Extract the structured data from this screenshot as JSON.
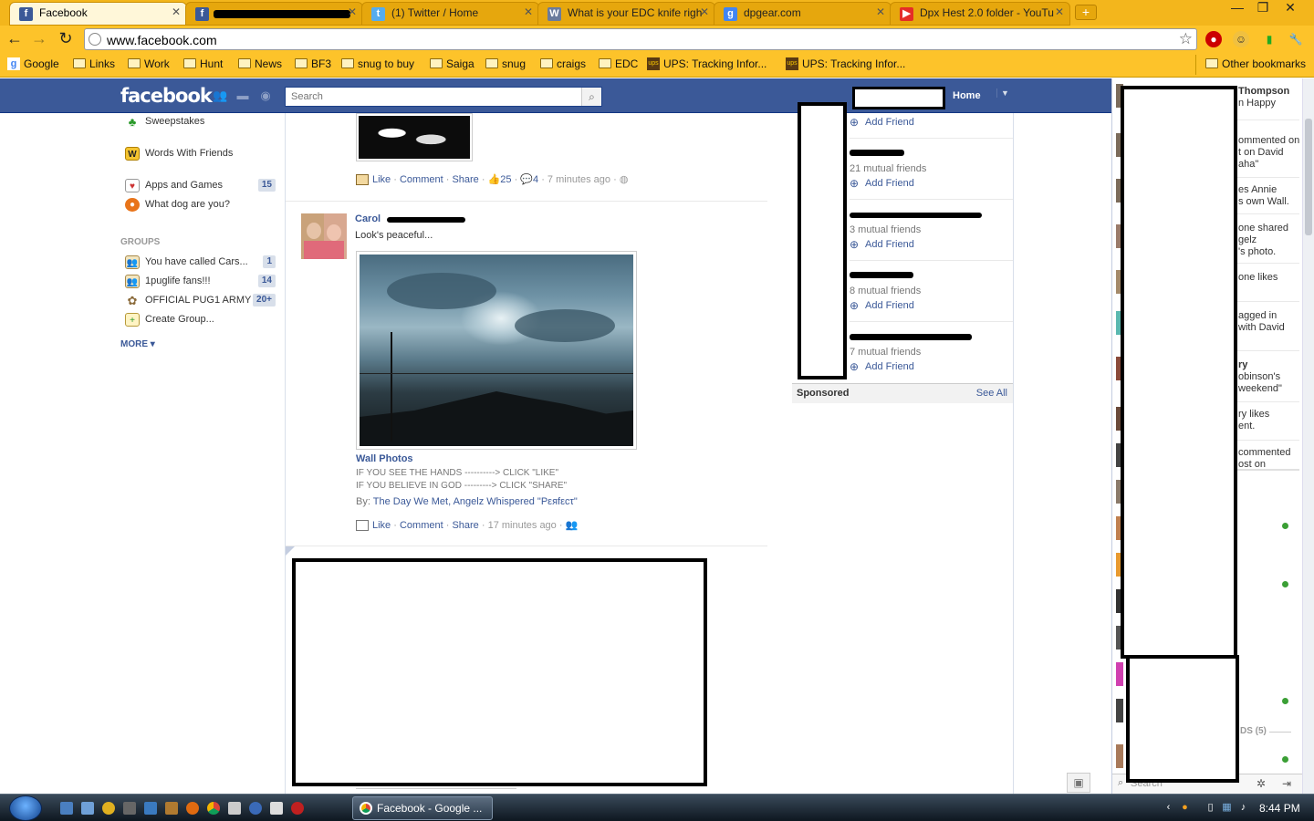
{
  "browser": {
    "tabs": [
      {
        "title": "Facebook",
        "favicon": "f",
        "color": "#3b5998"
      },
      {
        "title": "",
        "favicon": "f",
        "color": "#3b5998"
      },
      {
        "title": "(1) Twitter / Home",
        "favicon": "t",
        "color": "#55acee"
      },
      {
        "title": "What is your EDC knife righ",
        "favicon": "W",
        "color": "#6a7b9c"
      },
      {
        "title": "dpgear.com",
        "favicon": "g",
        "color": "#4285f4"
      },
      {
        "title": "Dpx Hest 2.0 folder - YouTu",
        "favicon": "▶",
        "color": "#e52d27"
      }
    ],
    "url": "www.facebook.com",
    "bookmarks": [
      {
        "label": "Google",
        "icon": "google-icon"
      },
      {
        "label": "Links",
        "icon": "folder-icon"
      },
      {
        "label": "Work",
        "icon": "folder-icon"
      },
      {
        "label": "Hunt",
        "icon": "folder-icon"
      },
      {
        "label": "News",
        "icon": "folder-icon"
      },
      {
        "label": "BF3",
        "icon": "folder-icon"
      },
      {
        "label": "snug to buy",
        "icon": "folder-icon"
      },
      {
        "label": "Saiga",
        "icon": "folder-icon"
      },
      {
        "label": "snug",
        "icon": "folder-icon"
      },
      {
        "label": "craigs",
        "icon": "folder-icon"
      },
      {
        "label": "EDC",
        "icon": "folder-icon"
      },
      {
        "label": "UPS: Tracking Infor...",
        "icon": "ups-icon"
      },
      {
        "label": "UPS: Tracking Infor...",
        "icon": "ups-icon"
      }
    ],
    "other_bookmarks": "Other bookmarks"
  },
  "fb": {
    "logo": "facebook",
    "search_placeholder": "Search",
    "home": "Home"
  },
  "leftnav": {
    "items": [
      {
        "label": "Sweepstakes",
        "icon": "clover-icon",
        "count": ""
      },
      {
        "label": "Words With Friends",
        "icon": "wwf-icon",
        "count": ""
      },
      {
        "label": "Apps and Games",
        "icon": "apps-icon",
        "count": "15"
      },
      {
        "label": "What dog are you?",
        "icon": "dog-icon",
        "count": ""
      }
    ],
    "groups_heading": "GROUPS",
    "groups": [
      {
        "label": "You have called Cars...",
        "count": "1"
      },
      {
        "label": "1puglife fans!!!",
        "count": "14"
      },
      {
        "label": "OFFICIAL PUG1 ARMY",
        "count": "20+"
      },
      {
        "label": "Create Group...",
        "count": ""
      }
    ],
    "more": "MORE ▾"
  },
  "feed": {
    "post1_actions": {
      "like": "Like",
      "comment": "Comment",
      "share": "Share",
      "likes": "25",
      "comments": "4",
      "time": "7 minutes ago"
    },
    "post2": {
      "author": "Carol",
      "text": "Look's peaceful...",
      "album": "Wall Photos",
      "caption1": "IF YOU SEE THE HANDS ----------> CLICK \"LIKE\"",
      "caption2": "IF YOU BELIEVE IN GOD ---------> CLICK \"SHARE\"",
      "by_label": "By:",
      "by_links": "The Day We Met, Angelz Whispered \"Pεяfεcτ\"",
      "like": "Like",
      "comment": "Comment",
      "share": "Share",
      "time": "17 minutes ago"
    }
  },
  "right": {
    "add_friend": "Add Friend",
    "mutuals": [
      "21 mutual friends",
      "3 mutual friends",
      "8 mutual friends",
      "7 mutual friends"
    ],
    "sponsored": "Sponsored",
    "see_all": "See All"
  },
  "ticker": {
    "lines": [
      "Thompson",
      "n Happy",
      "ommented on",
      "t on David",
      "aha\"",
      "es Annie",
      "s own Wall.",
      "one shared",
      "gelz",
      "'s photo.",
      "one likes",
      "agged in",
      "with David",
      "ry",
      "obinson's",
      " weekend\"",
      "ry likes",
      "ent.",
      "commented",
      "ost on"
    ],
    "friends_count": "DS (5)",
    "chat_search": "Search"
  },
  "taskbar": {
    "item": "Facebook - Google ...",
    "clock": "8:44 PM"
  }
}
